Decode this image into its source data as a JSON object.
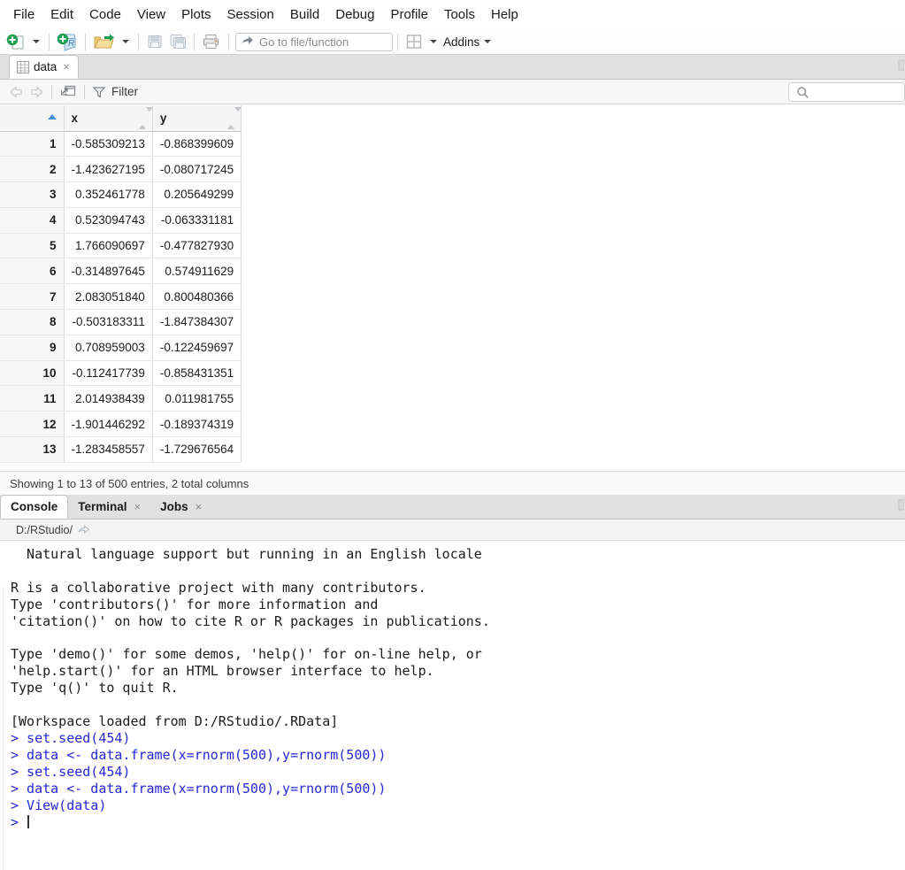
{
  "menu": {
    "items": [
      "File",
      "Edit",
      "Code",
      "View",
      "Plots",
      "Session",
      "Build",
      "Debug",
      "Profile",
      "Tools",
      "Help"
    ]
  },
  "toolbar": {
    "new_file_tooltip": "New File",
    "new_project_tooltip": "New Project",
    "open_tooltip": "Open an existing file",
    "save_tooltip": "Save current document",
    "save_all_tooltip": "Save all open documents",
    "print_tooltip": "Print",
    "goto_placeholder": "Go to file/function",
    "panes_tooltip": "Workspace Panes",
    "addins_label": "Addins"
  },
  "data_pane": {
    "tab_label": "data",
    "tab_close": "×",
    "filter_label": "Filter",
    "search_placeholder": "",
    "status": "Showing 1 to 13 of 500 entries, 2 total columns",
    "columns": [
      "",
      "x",
      "y"
    ],
    "rows": [
      {
        "n": "1",
        "x": "-0.585309213",
        "y": "-0.868399609"
      },
      {
        "n": "2",
        "x": "-1.423627195",
        "y": "-0.080717245"
      },
      {
        "n": "3",
        "x": "0.352461778",
        "y": "0.205649299"
      },
      {
        "n": "4",
        "x": "0.523094743",
        "y": "-0.063331181"
      },
      {
        "n": "5",
        "x": "1.766090697",
        "y": "-0.477827930"
      },
      {
        "n": "6",
        "x": "-0.314897645",
        "y": "0.574911629"
      },
      {
        "n": "7",
        "x": "2.083051840",
        "y": "0.800480366"
      },
      {
        "n": "8",
        "x": "-0.503183311",
        "y": "-1.847384307"
      },
      {
        "n": "9",
        "x": "0.708959003",
        "y": "-0.122459697"
      },
      {
        "n": "10",
        "x": "-0.112417739",
        "y": "-0.858431351"
      },
      {
        "n": "11",
        "x": "2.014938439",
        "y": "0.011981755"
      },
      {
        "n": "12",
        "x": "-1.901446292",
        "y": "-0.189374319"
      },
      {
        "n": "13",
        "x": "-1.283458557",
        "y": "-1.729676564"
      }
    ]
  },
  "console": {
    "tabs": [
      {
        "label": "Console",
        "closable": false,
        "active": true
      },
      {
        "label": "Terminal",
        "closable": true,
        "active": false
      },
      {
        "label": "Jobs",
        "closable": true,
        "active": false
      }
    ],
    "close_glyph": "×",
    "path": "D:/RStudio/",
    "output": "  Natural language support but running in an English locale\n\nR is a collaborative project with many contributors.\nType 'contributors()' for more information and\n'citation()' on how to cite R or R packages in publications.\n\nType 'demo()' for some demos, 'help()' for on-line help, or\n'help.start()' for an HTML browser interface to help.\nType 'q()' to quit R.\n\n[Workspace loaded from D:/RStudio/.RData]\n",
    "commands": "> set.seed(454)\n> data <- data.frame(x=rnorm(500),y=rnorm(500))\n> set.seed(454)\n> data <- data.frame(x=rnorm(500),y=rnorm(500))\n> View(data)\n> ",
    "prompt_symbol": ">"
  },
  "colors": {
    "command_blue": "#2727d6",
    "sort_blue": "#4a90d9",
    "tabstrip_gray": "#e1e1e1",
    "toolbar_gray": "#f7f7f7"
  }
}
